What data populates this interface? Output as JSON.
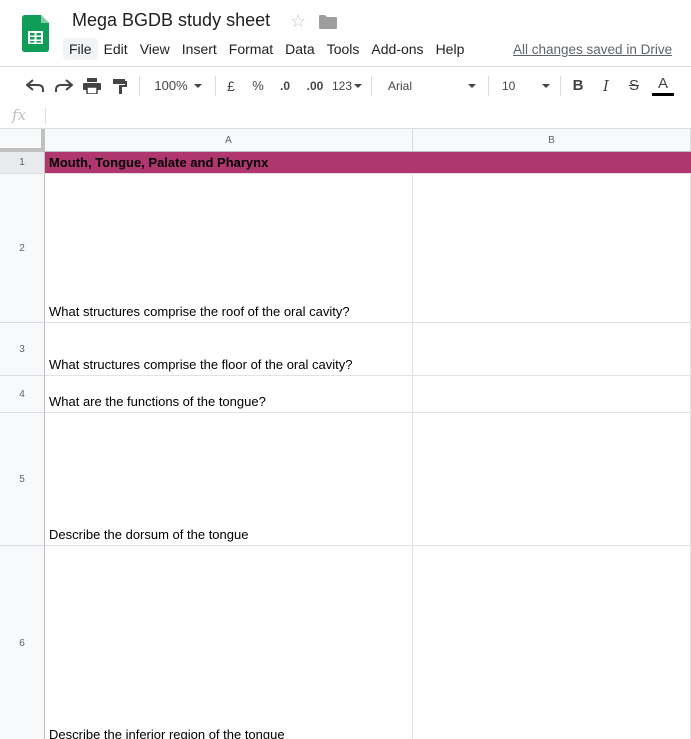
{
  "doc": {
    "title": "Mega BGDB study sheet",
    "saved_status": "All changes saved in Drive",
    "star_icon": "star-icon",
    "folder_icon": "folder-icon",
    "brand_color": "#0f9d58"
  },
  "menu": [
    "File",
    "Edit",
    "View",
    "Insert",
    "Format",
    "Data",
    "Tools",
    "Add-ons",
    "Help"
  ],
  "toolbar": {
    "zoom": "100%",
    "currency": "£",
    "percent": "%",
    "decrease_decimals": ".0",
    "increase_decimals": ".00",
    "more_formats": "123",
    "font": "Arial",
    "font_size": "10",
    "bold": "B",
    "italic": "I",
    "strikethrough": "S",
    "text_color": "A"
  },
  "formula_bar": {
    "fx": "fx",
    "value": ""
  },
  "columns": [
    "A",
    "B"
  ],
  "rows": [
    {
      "num": "1",
      "a": "Mouth, Tongue, Palate and Pharynx",
      "b": "",
      "fill": "#b0366f"
    },
    {
      "num": "2",
      "a": "What structures comprise the roof of the oral cavity?",
      "b": ""
    },
    {
      "num": "3",
      "a": "What structures comprise the floor of the oral cavity?",
      "b": ""
    },
    {
      "num": "4",
      "a": "What are the functions of the tongue?",
      "b": ""
    },
    {
      "num": "5",
      "a": "Describe the dorsum of the tongue",
      "b": ""
    },
    {
      "num": "6",
      "a": "Describe the inferior region of the tongue",
      "b": ""
    }
  ]
}
